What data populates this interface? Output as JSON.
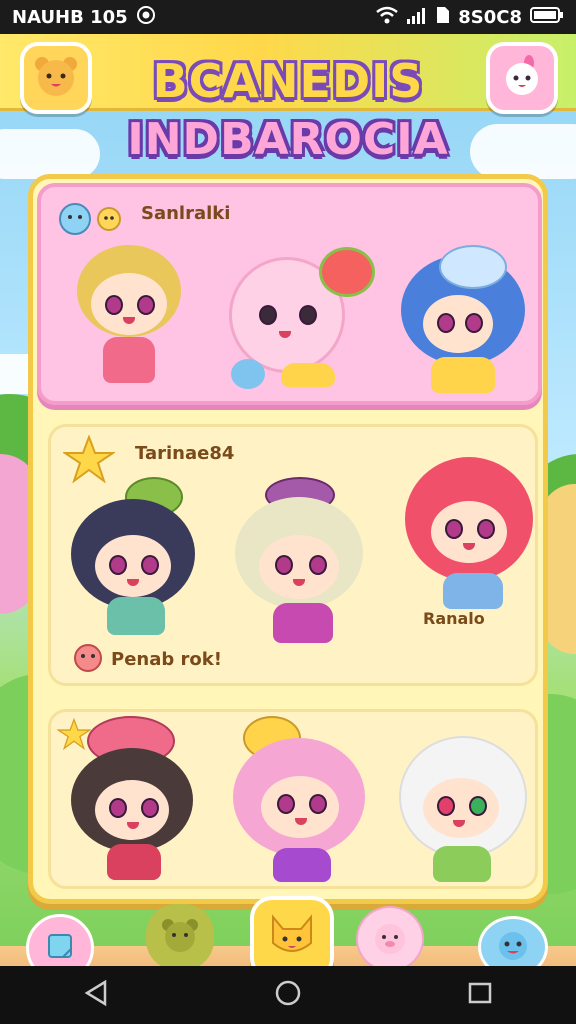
{
  "status_bar": {
    "left_text": "NAUHB 105",
    "right_text": "8S0C8",
    "icons": [
      "target-icon",
      "wifi-icon",
      "signal-icon",
      "sim-icon",
      "battery-icon"
    ]
  },
  "header": {
    "title_line1": "BCANEDIS",
    "title_line2": "INDBAROCIA",
    "left_button_icon": "bear-face-icon",
    "right_button_icon": "bunny-face-icon"
  },
  "sections": [
    {
      "label": "Sanlralki",
      "label_icon": "mini-mascots-icon"
    },
    {
      "label": "Tarinae84",
      "label_icon": "star-icon",
      "caption_left": "Penab rok!",
      "caption_right": "Ranalo"
    },
    {
      "label": "",
      "label_icon": "star-icon"
    }
  ],
  "bottom_nav": {
    "items": [
      "note-icon",
      "bear-icon",
      "cat-face-icon",
      "pig-icon",
      "blue-mascot-icon"
    ]
  },
  "system_nav": [
    "back-icon",
    "home-icon",
    "recents-icon"
  ],
  "colors": {
    "topbar": "#ffd84a",
    "board": "#fff6b8",
    "card_pink": "#ffc3e3",
    "card_cream": "#fff3c6",
    "title_outline": "#7a4ab8"
  }
}
